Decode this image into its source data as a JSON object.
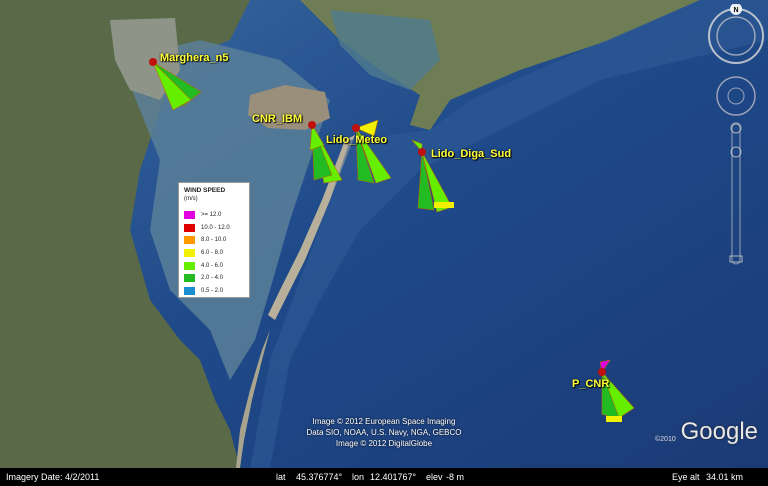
{
  "window_title": "",
  "stations": [
    {
      "name": "Marghera_n5"
    },
    {
      "name": "CNR_IBM"
    },
    {
      "name": "Lido_Meteo"
    },
    {
      "name": "Lido_Diga_Sud"
    },
    {
      "name": "P_CNR"
    }
  ],
  "legend": {
    "title": "WIND SPEED",
    "unit": "(m/s)",
    "items": [
      {
        "label": ">= 12.0",
        "color": "#e000e0"
      },
      {
        "label": "10.0 - 12.0",
        "color": "#e00000"
      },
      {
        "label": "8.0 - 10.0",
        "color": "#ff9900"
      },
      {
        "label": "6.0 - 8.0",
        "color": "#f0f000"
      },
      {
        "label": "4.0 - 6.0",
        "color": "#66ee00"
      },
      {
        "label": "2.0 - 4.0",
        "color": "#22bb22"
      },
      {
        "label": "0.5 - 2.0",
        "color": "#1a8fd0"
      }
    ]
  },
  "credits": [
    "Image © 2012 European Space Imaging",
    "Data SIO, NOAA, U.S. Navy, NGA, GEBCO",
    "Image © 2012 DigitalGlobe"
  ],
  "logo": {
    "copyright": "©2010",
    "text": "Google"
  },
  "status_bar": {
    "imagery_date": "Imagery Date: 4/2/2011",
    "lat_label": "lat",
    "lat": "45.376774°",
    "lon_label": "lon",
    "lon": "12.401767°",
    "elev_label": "elev",
    "elev": "-8 m",
    "eye_alt_label": "Eye alt",
    "eye_alt": "34.01 km"
  },
  "compass": {
    "north": "N"
  }
}
